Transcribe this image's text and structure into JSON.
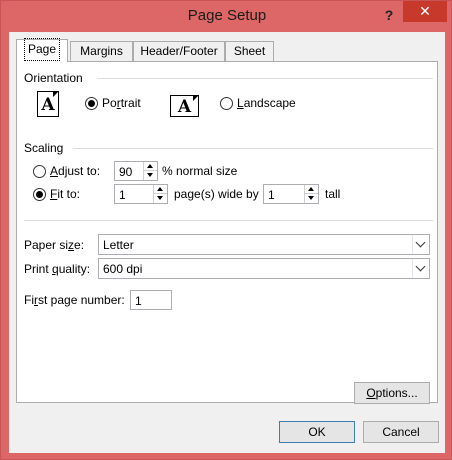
{
  "window": {
    "title": "Page Setup",
    "help_glyph": "?",
    "close_glyph": "✕"
  },
  "tabs": [
    {
      "label": "Page"
    },
    {
      "label": "Margins"
    },
    {
      "label": "Header/Footer"
    },
    {
      "label": "Sheet"
    }
  ],
  "orientation": {
    "title": "Orientation",
    "icon_letter": "A",
    "portrait": {
      "prefix": "Po",
      "accel": "r",
      "suffix": "trait",
      "checked": true
    },
    "landscape": {
      "prefix": "",
      "accel": "L",
      "suffix": "andscape",
      "checked": false
    }
  },
  "scaling": {
    "title": "Scaling",
    "adjust": {
      "prefix": "",
      "accel": "A",
      "suffix": "djust to:",
      "value": "90",
      "unit": "% normal size",
      "checked": false
    },
    "fit": {
      "prefix": "",
      "accel": "F",
      "suffix": "it to:",
      "wide_value": "1",
      "wide_label": "page(s) wide by",
      "tall_value": "1",
      "tall_label": "tall",
      "checked": true
    }
  },
  "paper_size": {
    "prefix": "Paper si",
    "accel": "z",
    "suffix": "e:",
    "value": "Letter"
  },
  "print_quality": {
    "prefix": "Print ",
    "accel": "q",
    "suffix": "uality:",
    "value": "600 dpi"
  },
  "first_page": {
    "prefix": "Fi",
    "accel": "r",
    "suffix": "st page number:",
    "value": "1"
  },
  "buttons": {
    "options": {
      "prefix": "",
      "accel": "O",
      "suffix": "ptions..."
    },
    "ok": "OK",
    "cancel": "Cancel"
  },
  "colors": {
    "frame": "#dd6666",
    "close": "#c7392b",
    "panel": "#ffffff",
    "client": "#f0f0f0"
  }
}
